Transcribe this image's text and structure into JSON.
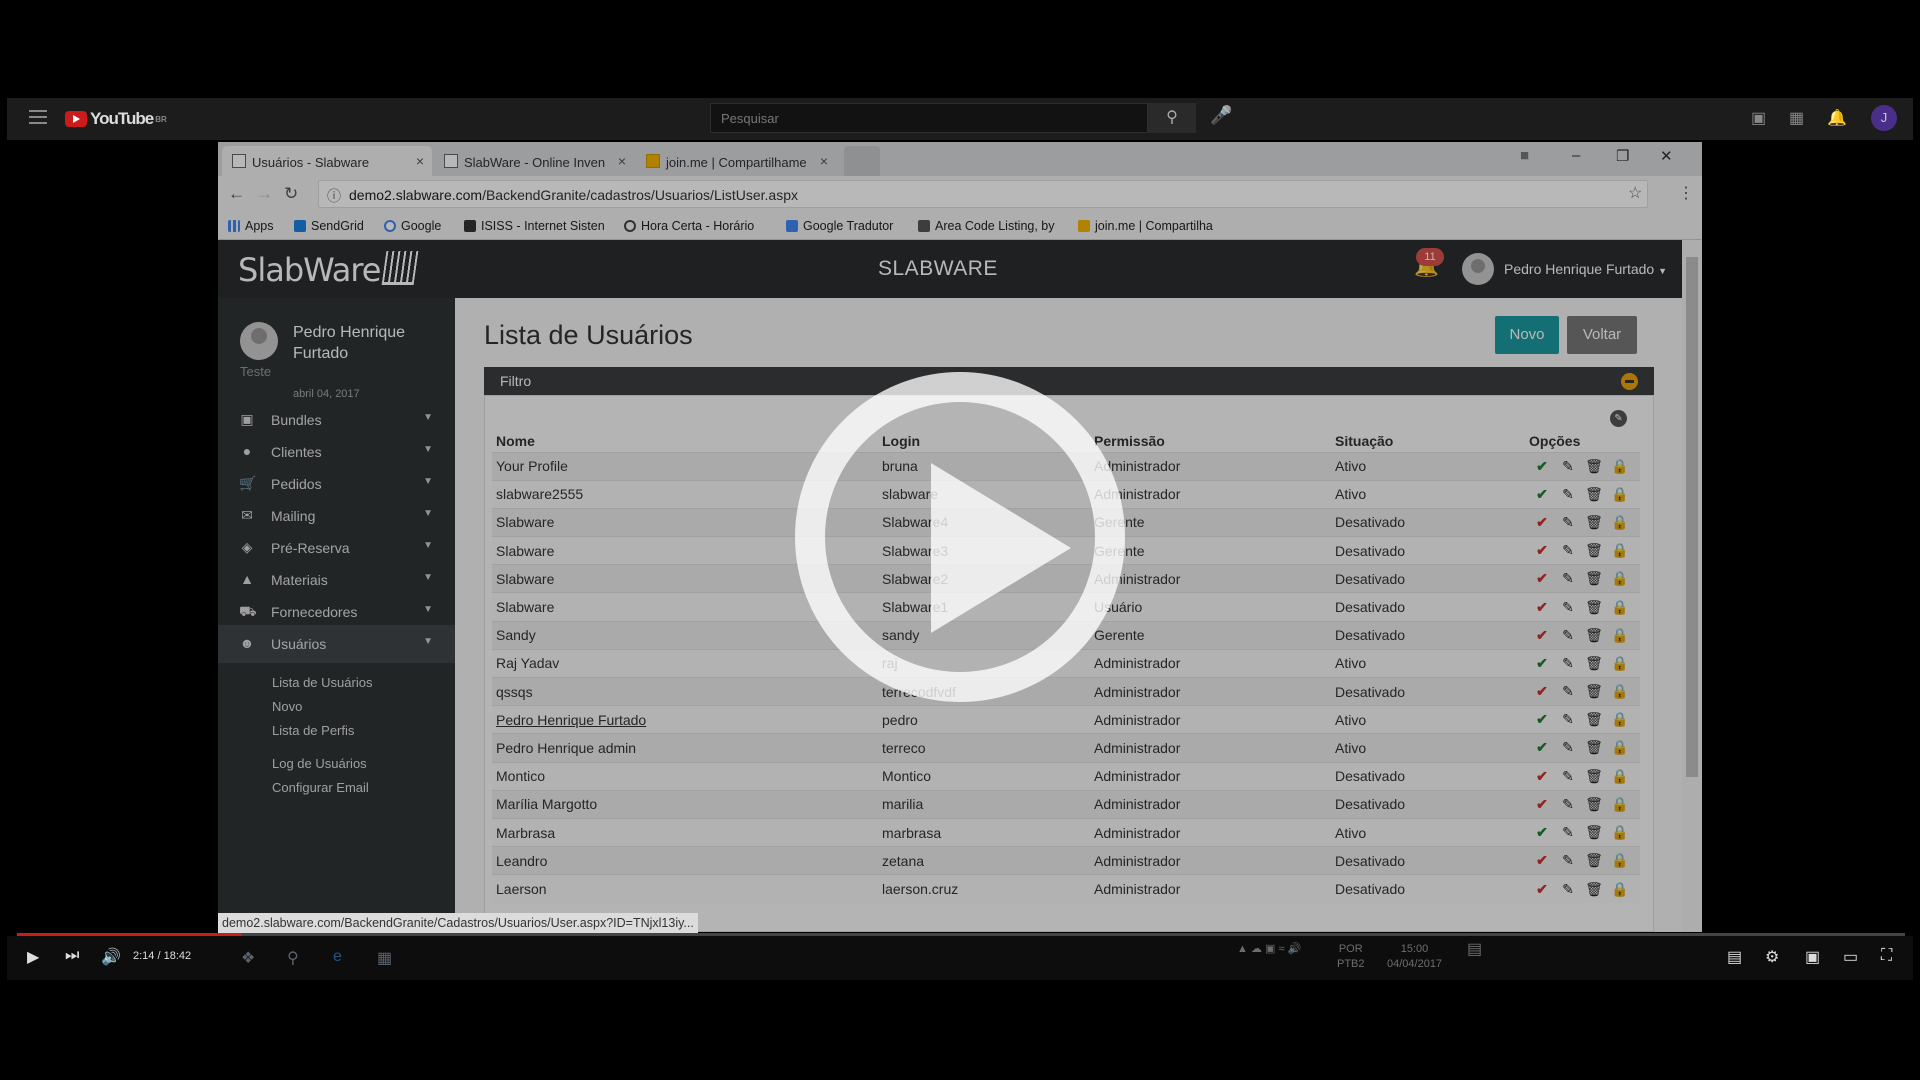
{
  "youtube": {
    "logo_text": "YouTube",
    "region": "BR",
    "search_placeholder": "Pesquisar",
    "avatar_letter": "J"
  },
  "browser": {
    "tabs": [
      {
        "title": "Usuários - Slabware",
        "active": true
      },
      {
        "title": "SlabWare - Online Inven",
        "active": false
      },
      {
        "title": "join.me | Compartilhame",
        "active": false
      }
    ],
    "url_host": "demo2.slabware.com",
    "url_path": "/BackendGranite/cadastros/Usuarios/ListUser.aspx",
    "bookmarks": [
      "Apps",
      "SendGrid",
      "Google",
      "ISISS - Internet Sisten",
      "Hora Certa - Horário",
      "Google Tradutor",
      "Area Code Listing, by",
      "join.me | Compartilha"
    ],
    "status_url": "demo2.slabware.com/BackendGranite/Cadastros/Usuarios/User.aspx?ID=TNjxl13iy..."
  },
  "app": {
    "logo": "SlabWare",
    "brand": "SLABWARE",
    "notifications": "11",
    "user_name": "Pedro Henrique Furtado",
    "sidebar": {
      "profile_name": "Pedro Henrique Furtado",
      "profile_role": "Teste",
      "profile_date": "abril 04, 2017",
      "items": [
        {
          "label": "Bundles",
          "icon": "cubes-icon"
        },
        {
          "label": "Clientes",
          "icon": "users-icon"
        },
        {
          "label": "Pedidos",
          "icon": "cart-icon"
        },
        {
          "label": "Mailing",
          "icon": "envelope-icon"
        },
        {
          "label": "Pré-Reserva",
          "icon": "tags-icon"
        },
        {
          "label": "Materiais",
          "icon": "cube-icon"
        },
        {
          "label": "Fornecedores",
          "icon": "truck-icon"
        },
        {
          "label": "Usuários",
          "icon": "user-icon"
        }
      ],
      "subitems": [
        "Lista de Usuários",
        "Novo",
        "Lista de Perfis",
        "Log de Usuários",
        "Configurar Email"
      ]
    },
    "page_title": "Lista de Usuários",
    "btn_new": "Novo",
    "btn_back": "Voltar",
    "filter_label": "Filtro",
    "columns": [
      "Nome",
      "Login",
      "Permissão",
      "Situação",
      "Opções"
    ],
    "rows": [
      {
        "nome": "Your Profile",
        "login": "bruna",
        "permissao": "Administrador",
        "situacao": "Ativo"
      },
      {
        "nome": "slabware2555",
        "login": "slabware",
        "permissao": "Administrador",
        "situacao": "Ativo"
      },
      {
        "nome": "Slabware",
        "login": "Slabware4",
        "permissao": "Gerente",
        "situacao": "Desativado"
      },
      {
        "nome": "Slabware",
        "login": "Slabware3",
        "permissao": "Gerente",
        "situacao": "Desativado"
      },
      {
        "nome": "Slabware",
        "login": "Slabware2",
        "permissao": "Administrador",
        "situacao": "Desativado"
      },
      {
        "nome": "Slabware",
        "login": "Slabware1",
        "permissao": "Usuário",
        "situacao": "Desativado"
      },
      {
        "nome": "Sandy",
        "login": "sandy",
        "permissao": "Gerente",
        "situacao": "Desativado"
      },
      {
        "nome": "Raj Yadav",
        "login": "raj",
        "permissao": "Administrador",
        "situacao": "Ativo"
      },
      {
        "nome": "qssqs",
        "login": "terrecodfvdf",
        "permissao": "Administrador",
        "situacao": "Desativado"
      },
      {
        "nome": "Pedro Henrique Furtado",
        "login": "pedro",
        "permissao": "Administrador",
        "situacao": "Ativo"
      },
      {
        "nome": "Pedro Henrique admin",
        "login": "terreco",
        "permissao": "Administrador",
        "situacao": "Ativo"
      },
      {
        "nome": "Montico",
        "login": "Montico",
        "permissao": "Administrador",
        "situacao": "Desativado"
      },
      {
        "nome": "Marília Margotto",
        "login": "marilia",
        "permissao": "Administrador",
        "situacao": "Desativado"
      },
      {
        "nome": "Marbrasa",
        "login": "marbrasa",
        "permissao": "Administrador",
        "situacao": "Ativo"
      },
      {
        "nome": "Leandro",
        "login": "zetana",
        "permissao": "Administrador",
        "situacao": "Desativado"
      },
      {
        "nome": "Laerson",
        "login": "laerson.cruz",
        "permissao": "Administrador",
        "situacao": "Desativado"
      }
    ]
  },
  "player": {
    "time": "2:14 / 18:42",
    "progress_fraction": 0.119,
    "clock_time": "15:00",
    "clock_date": "04/04/2017",
    "lang": "POR",
    "kbd": "PTB2"
  },
  "colors": {
    "accent_teal": "#1a9aa0",
    "btn_grey": "#777777",
    "yt_red": "#cc1b1b",
    "ok_green": "#1e7e34",
    "no_red": "#c9302c"
  }
}
